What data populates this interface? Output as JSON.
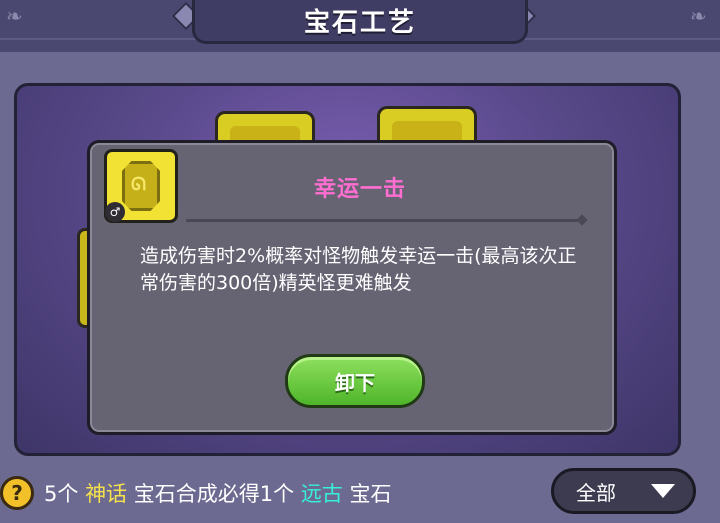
{
  "header": {
    "title": "宝石工艺"
  },
  "dialog": {
    "skill_name": "幸运一击",
    "description": "造成伤害时2%概率对怪物触发幸运一击(最高该次正常伤害的300倍)精英怪更难触发",
    "unequip_label": "卸下",
    "badge_glyph": "♂"
  },
  "footer": {
    "help_glyph": "?",
    "hint_prefix": "5个",
    "hint_mythic": "神话",
    "hint_middle": "宝石合成必得1个",
    "hint_ancient": "远古",
    "hint_suffix": "宝石",
    "filter_label": "全部"
  },
  "colors": {
    "skill_name": "#ff6ed0",
    "mythic": "#f6e24a",
    "ancient": "#36f0d8",
    "button_green": "#5cc234"
  },
  "icons": [
    "gem-icon",
    "swirl-icon",
    "male-badge-icon",
    "help-icon",
    "dropdown-arrow-icon"
  ]
}
